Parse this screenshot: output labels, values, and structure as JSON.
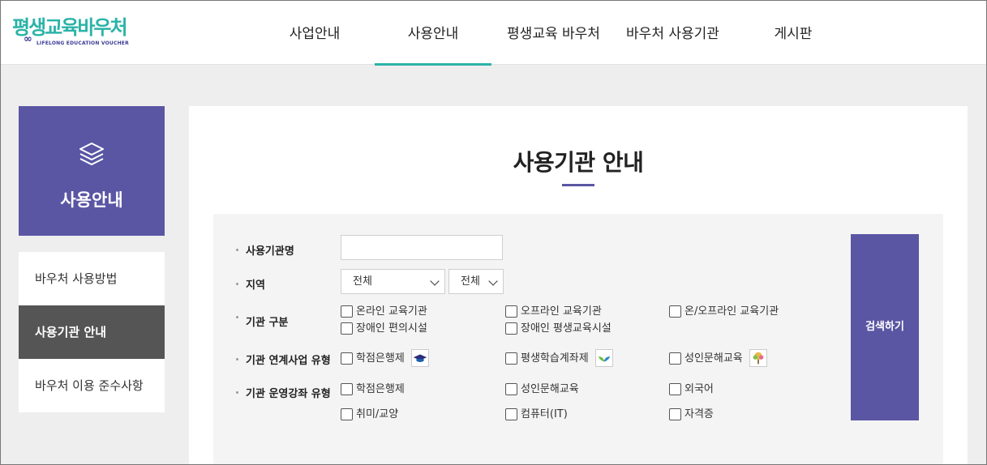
{
  "header": {
    "logo_text": "평생교육바우처",
    "logo_subtext": "LIFELONG EDUCATION VOUCHER",
    "nav": [
      {
        "label": "사업안내"
      },
      {
        "label": "사용안내"
      },
      {
        "label": "평생교육 바우처"
      },
      {
        "label": "바우처 사용기관"
      },
      {
        "label": "게시판"
      }
    ]
  },
  "sidebar": {
    "title": "사용안내",
    "items": [
      {
        "label": "바우처 사용방법"
      },
      {
        "label": "사용기관 안내"
      },
      {
        "label": "바우처 이용 준수사항"
      }
    ]
  },
  "main": {
    "title": "사용기관 안내",
    "search": {
      "name_label": "사용기관명",
      "name_value": "",
      "region_label": "지역",
      "region_select_1": "전체",
      "region_select_2": "전체",
      "type_label": "기관 구분",
      "type_options": [
        "온라인 교육기관",
        "오프라인 교육기관",
        "온/오프라인 교육기관",
        "장애인 편의시설",
        "장애인 평생교육시설"
      ],
      "program_label": "기관 연계사업 유형",
      "program_options": [
        "학점은행제",
        "평생학습계좌제",
        "성인문해교육"
      ],
      "course_label": "기관 운영강좌 유형",
      "course_options": [
        "학점은행제",
        "성인문해교육",
        "외국어",
        "취미/교양",
        "컴퓨터(IT)",
        "자격증"
      ],
      "button_label": "검색하기"
    }
  },
  "colors": {
    "accent_teal": "#2bb3a8",
    "brand_purple": "#5a56a4",
    "active_gray": "#555555"
  }
}
